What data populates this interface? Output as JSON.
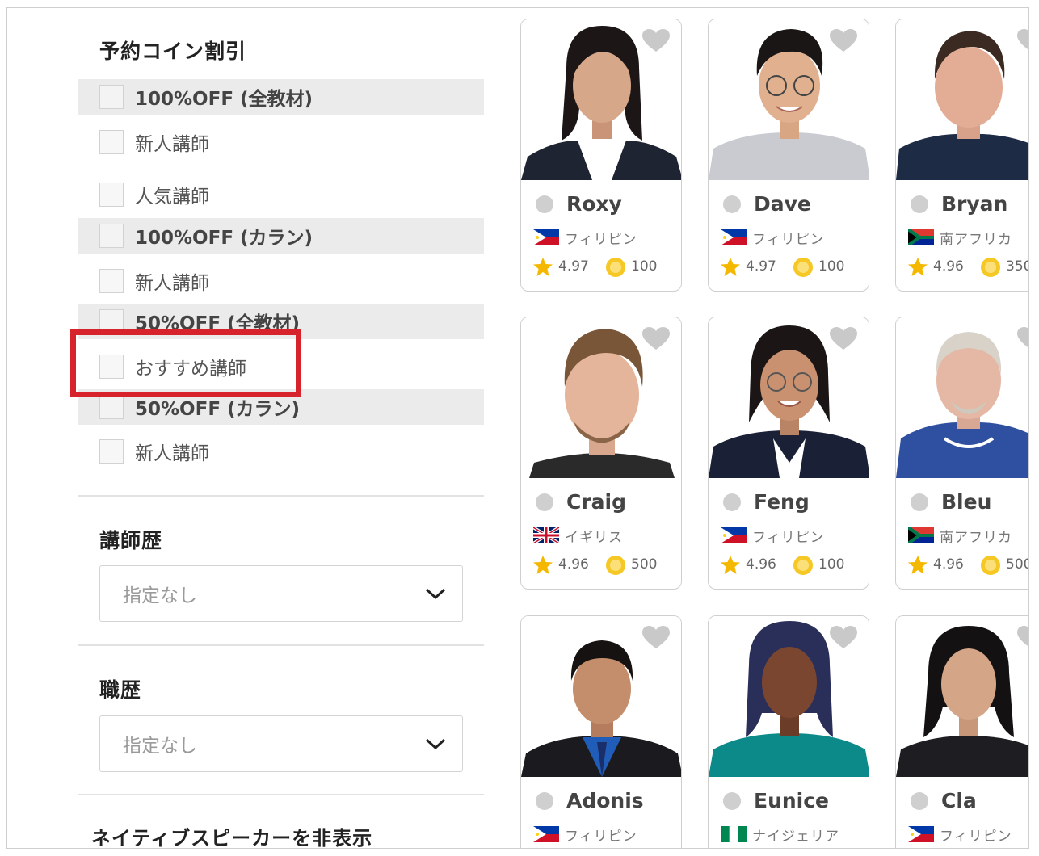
{
  "sidebar": {
    "discount_title": "予約コイン割引",
    "discount_rows": [
      {
        "label": "100%OFF (全教材)",
        "group": true
      },
      {
        "label": "新人講師",
        "group": false
      },
      {
        "label": "人気講師",
        "group": false
      },
      {
        "label": "100%OFF (カラン)",
        "group": true
      },
      {
        "label": "新人講師",
        "group": false
      },
      {
        "label": "50%OFF (全教材)",
        "group": true
      },
      {
        "label": "おすすめ講師",
        "group": false
      },
      {
        "label": "50%OFF (カラン)",
        "group": true
      },
      {
        "label": "新人講師",
        "group": false
      }
    ],
    "experience_title": "講師歴",
    "experience_select": "指定なし",
    "career_title": "職歴",
    "career_select": "指定なし",
    "native_title": "ネイティブスピーカーを非表示"
  },
  "teachers": [
    {
      "name": "Roxy",
      "country": "フィリピン",
      "flag": "philippines-flag",
      "rating": "4.97",
      "price": "100",
      "status": "offline"
    },
    {
      "name": "Dave",
      "country": "フィリピン",
      "flag": "philippines-flag",
      "rating": "4.97",
      "price": "100",
      "status": "offline"
    },
    {
      "name": "Bryan",
      "country": "南アフリカ",
      "flag": "south-africa-flag",
      "rating": "4.96",
      "price": "350",
      "status": "offline"
    },
    {
      "name": "Craig",
      "country": "イギリス",
      "flag": "uk-flag",
      "rating": "4.96",
      "price": "500",
      "status": "offline"
    },
    {
      "name": "Feng",
      "country": "フィリピン",
      "flag": "philippines-flag",
      "rating": "4.96",
      "price": "100",
      "status": "offline"
    },
    {
      "name": "Bleu",
      "country": "南アフリカ",
      "flag": "south-africa-flag",
      "rating": "4.96",
      "price": "500",
      "status": "offline"
    },
    {
      "name": "Adonis",
      "country": "フィリピン",
      "flag": "philippines-flag",
      "status": "offline"
    },
    {
      "name": "Eunice",
      "country": "ナイジェリア",
      "flag": "nigeria-flag",
      "status": "offline"
    },
    {
      "name": "Cla",
      "country": "フィリピン",
      "flag": "philippines-flag",
      "status": "offline"
    }
  ],
  "colors": {
    "highlight": "#d7242c",
    "star": "#f5b800",
    "coin": "#f6c825",
    "group_row_bg": "#ebebeb"
  }
}
